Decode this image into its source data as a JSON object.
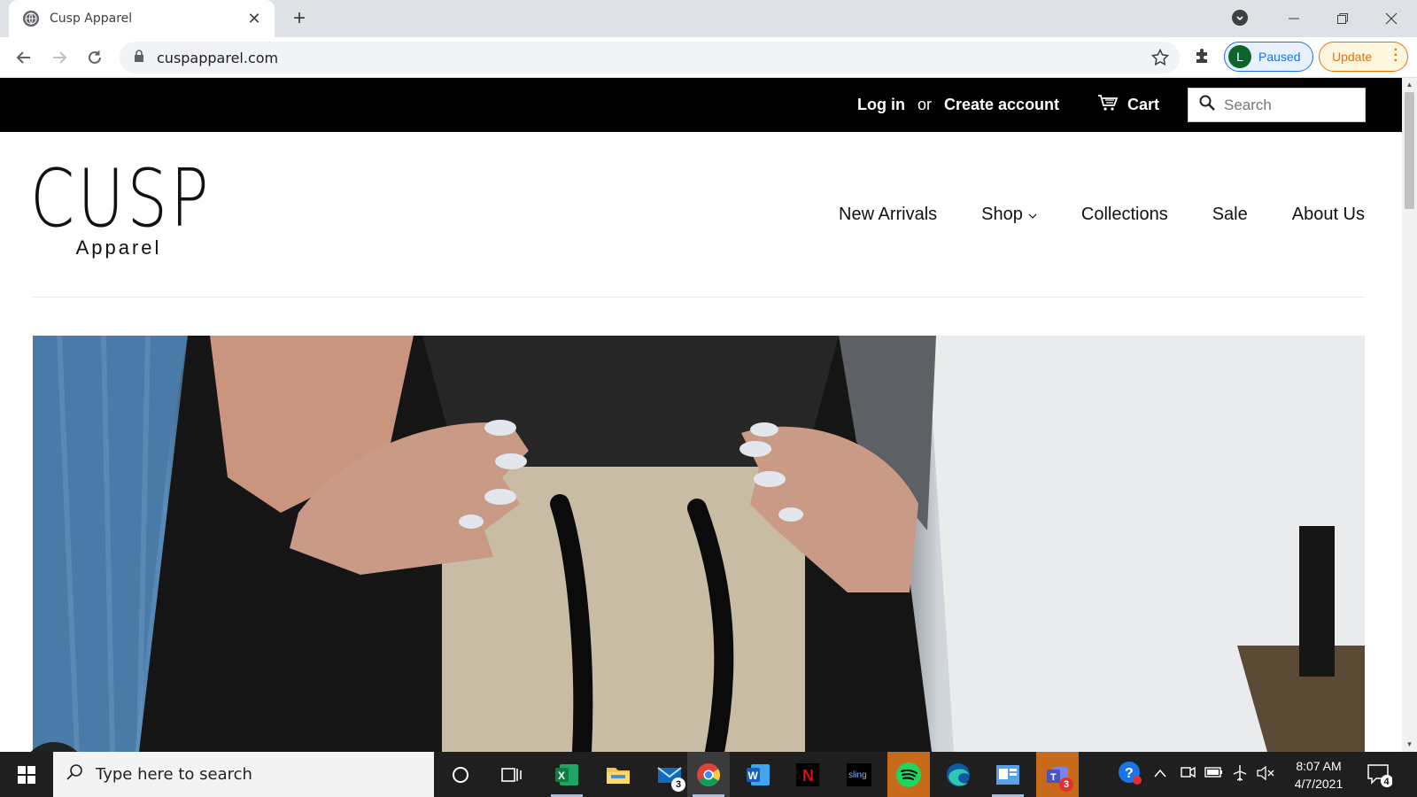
{
  "browser": {
    "tab_title": "Cusp Apparel",
    "tab_close": "✕",
    "new_tab": "+",
    "url": "cuspapparel.com",
    "profile_initial": "L",
    "profile_status": "Paused",
    "update_label": "Update"
  },
  "site": {
    "topbar": {
      "login": "Log in",
      "or": "or",
      "create_account": "Create account",
      "cart": "Cart",
      "search_placeholder": "Search"
    },
    "logo": {
      "main": "CUSP",
      "sub": "Apparel"
    },
    "nav": {
      "items": [
        {
          "label": "New Arrivals"
        },
        {
          "label": "Shop"
        },
        {
          "label": "Collections"
        },
        {
          "label": "Sale"
        },
        {
          "label": "About Us"
        }
      ]
    },
    "hero": {
      "image_desc": "hero-photo"
    }
  },
  "taskbar": {
    "search_placeholder": "Type here to search",
    "mail_badge": "3",
    "teams_badge": "3",
    "time": "8:07 AM",
    "date": "4/7/2021",
    "notifications_count": "4"
  },
  "colors": {
    "topbar_bg": "#000000",
    "chrome_tab_strip": "#dee1e6",
    "update_accent": "#e8710a",
    "profile_accent": "#1a73e8"
  }
}
